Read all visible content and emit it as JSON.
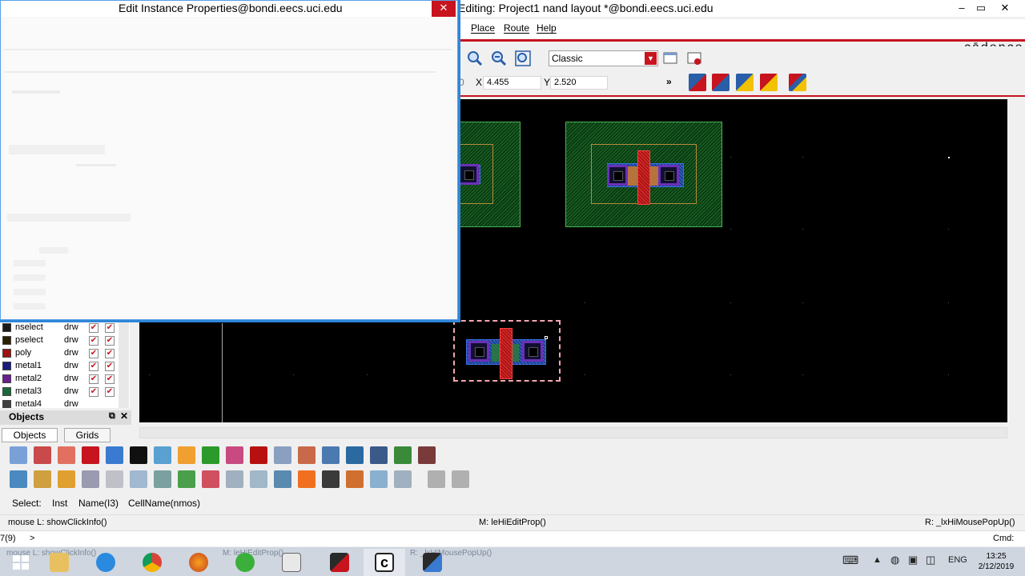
{
  "main_window": {
    "title": "Editing: Project1 nand layout *@bondi.eecs.uci.edu",
    "menus": [
      "Place",
      "Route",
      "Help"
    ],
    "logo": "cādence",
    "controls": {
      "minimize": "–",
      "maximize": "▭",
      "close": "✕"
    }
  },
  "toolbar": {
    "view_mode": "Classic",
    "coord_partial": "0",
    "x_label": "X",
    "x_value": "4.455",
    "y_label": "Y",
    "y_value": "2.520",
    "more": "»"
  },
  "dialog": {
    "title": "Edit Instance Properties@bondi.eecs.uci.edu",
    "close": "✕"
  },
  "layers": [
    {
      "name": "nselect",
      "purpose": "drw",
      "color": "#1a1a1a"
    },
    {
      "name": "pselect",
      "purpose": "drw",
      "color": "#2a2000"
    },
    {
      "name": "poly",
      "purpose": "drw",
      "color": "#a01010"
    },
    {
      "name": "metal1",
      "purpose": "drw",
      "color": "#1a1a80"
    },
    {
      "name": "metal2",
      "purpose": "drw",
      "color": "#6a2090"
    },
    {
      "name": "metal3",
      "purpose": "drw",
      "color": "#1a6a3a"
    },
    {
      "name": "metal4",
      "purpose": "drw",
      "color": "#404040"
    }
  ],
  "objects_panel": {
    "header": "Objects",
    "tabs": [
      "Objects",
      "Grids"
    ]
  },
  "status": {
    "select_label": "Select:",
    "select_type": "Inst",
    "select_name": "Name(I3)",
    "select_cell": "CellName(nmos)",
    "mouse_left": "mouse L: showClickInfo()",
    "mouse_middle": "M: leHiEditProp()",
    "mouse_right": "R: _lxHiMousePopUp()",
    "prompt_count": "7(9)",
    "prompt": ">",
    "cmd_label": "Cmd:"
  },
  "taskbar": {
    "language": "ENG",
    "time": "13:25",
    "date": "2/12/2019",
    "ghost_text_left": "mouse L: showClickInfo()",
    "ghost_text_mid": "M: leHiEditProp()",
    "ghost_text_right": "R: _lxHiMousePopUp()"
  },
  "colors": {
    "accent": "#c8141e",
    "canvas": "#000000",
    "nwell": "#1f6b2a",
    "poly": "#e43030",
    "active": "#3a6ad0",
    "contact": "#6a30b8"
  }
}
